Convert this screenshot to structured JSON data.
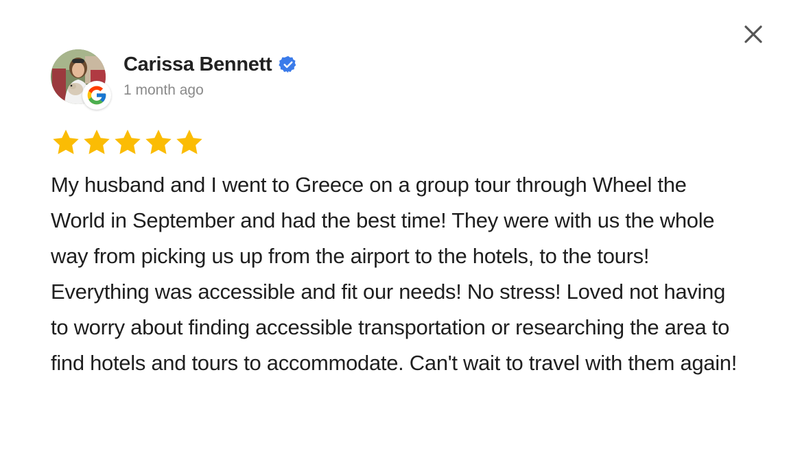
{
  "review": {
    "reviewer_name": "Carissa Bennett",
    "verified": true,
    "date": "1 month ago",
    "source_icon": "google-icon",
    "rating": 5,
    "rating_max": 5,
    "text": "My husband and I went to Greece on a group tour through Wheel the World in September and had the best time! They were with us the whole way from picking us up from the airport to the hotels, to the tours! Everything was accessible and fit our needs! No stress! Loved not having to worry about finding accessible transportation or researching the area to find hotels and tours to accommodate. Can't wait to travel with them again!"
  },
  "icons": {
    "close": "close-icon",
    "verified": "verified-badge-icon",
    "star": "star-icon"
  },
  "colors": {
    "star": "#FBBC04",
    "verified": "#3B7BEA",
    "name": "#222222",
    "date": "#8A8A8A",
    "body_text": "#1F1F1F",
    "close": "#555555"
  }
}
